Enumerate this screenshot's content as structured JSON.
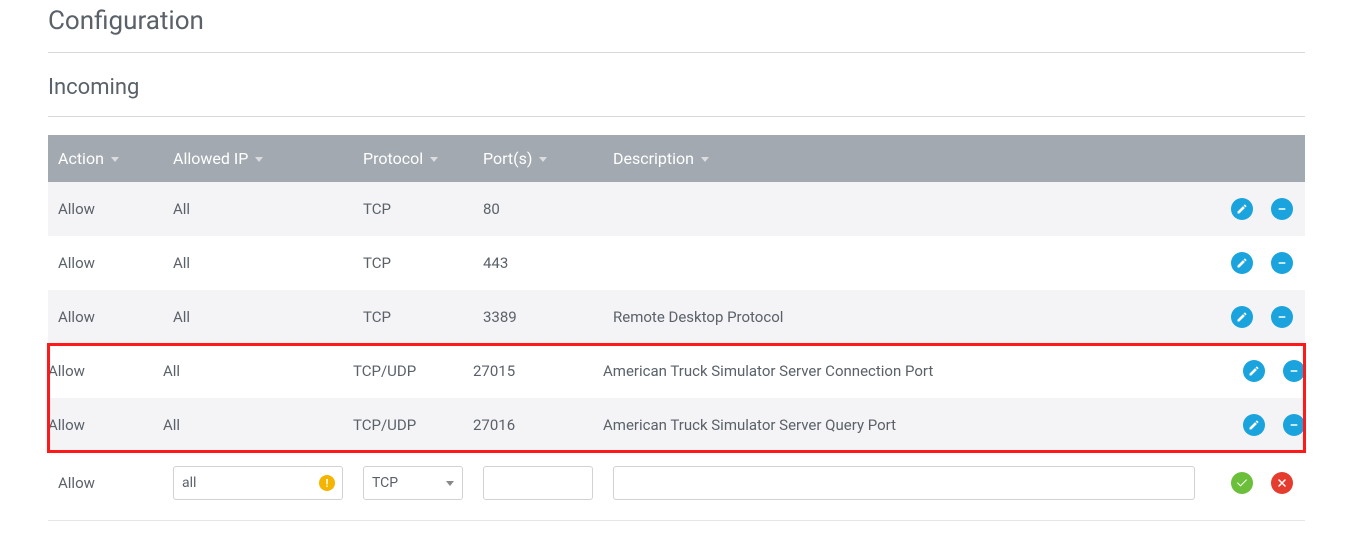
{
  "page_title": "Configuration",
  "section_title": "Incoming",
  "columns": {
    "action": "Action",
    "ip": "Allowed IP",
    "protocol": "Protocol",
    "ports": "Port(s)",
    "description": "Description"
  },
  "rows": [
    {
      "action": "Allow",
      "ip": "All",
      "protocol": "TCP",
      "ports": "80",
      "description": "",
      "highlighted": false
    },
    {
      "action": "Allow",
      "ip": "All",
      "protocol": "TCP",
      "ports": "443",
      "description": "",
      "highlighted": false
    },
    {
      "action": "Allow",
      "ip": "All",
      "protocol": "TCP",
      "ports": "3389",
      "description": "Remote Desktop Protocol",
      "highlighted": false
    },
    {
      "action": "Allow",
      "ip": "All",
      "protocol": "TCP/UDP",
      "ports": "27015",
      "description": "American Truck Simulator Server Connection Port",
      "highlighted": true
    },
    {
      "action": "Allow",
      "ip": "All",
      "protocol": "TCP/UDP",
      "ports": "27016",
      "description": "American Truck Simulator Server Query Port",
      "highlighted": true
    }
  ],
  "add_row": {
    "action_label": "Allow",
    "ip_value": "all",
    "ip_placeholder": "",
    "protocol_value": "TCP",
    "port_value": "",
    "description_value": ""
  },
  "icons": {
    "edit": "edit-icon",
    "remove": "remove-icon",
    "confirm": "confirm-icon",
    "cancel": "cancel-icon",
    "warning": "warning-icon"
  },
  "colors": {
    "header_bg": "#a2a9b0",
    "edit_btn": "#1aa3dd",
    "remove_btn": "#1aa3dd",
    "confirm_btn": "#6bbf3b",
    "cancel_btn": "#e43d30",
    "highlight_border": "#ff1a1a"
  }
}
